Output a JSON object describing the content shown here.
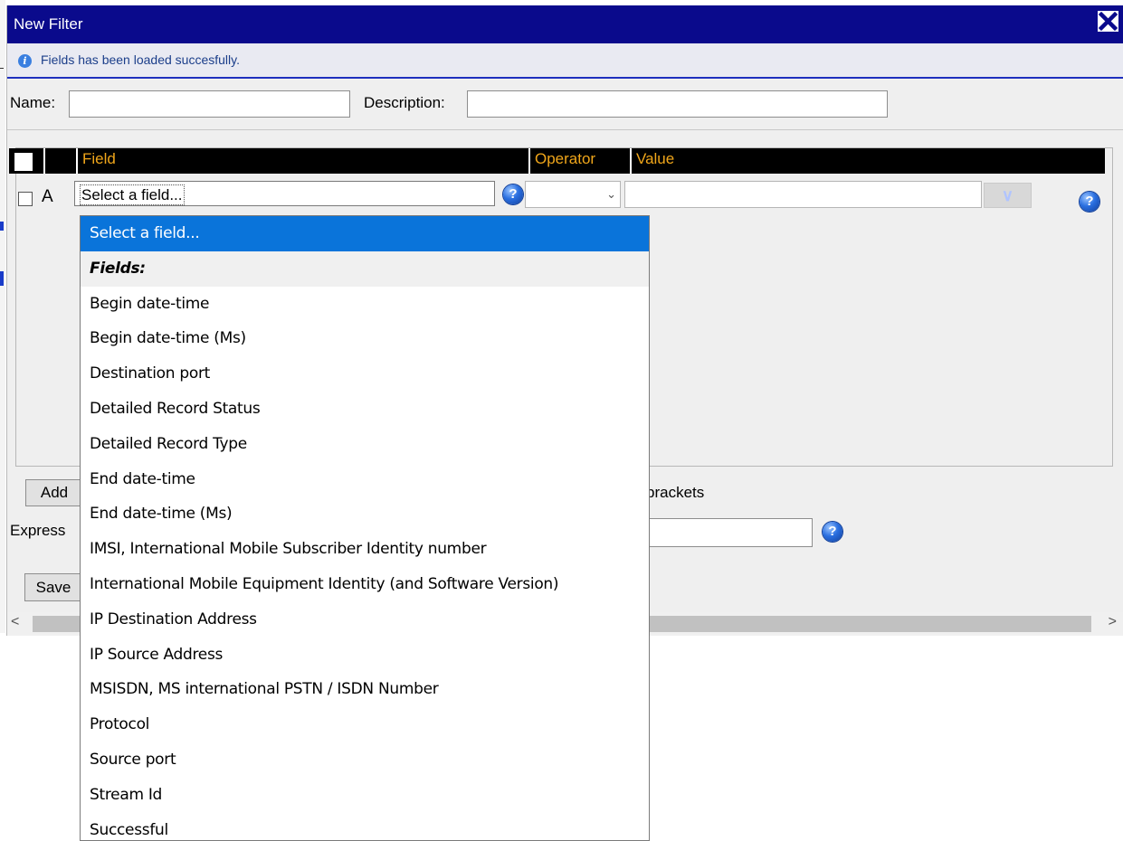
{
  "window": {
    "title": "New Filter",
    "close_icon": "close-x-icon"
  },
  "info": {
    "icon": "info-icon",
    "message": "Fields has been loaded succesfully."
  },
  "form": {
    "name_label": "Name:",
    "name_value": "",
    "description_label": "Description:",
    "description_value": ""
  },
  "grid": {
    "columns": {
      "field": "Field",
      "operator": "Operator",
      "value": "Value"
    },
    "rows": [
      {
        "letter": "A",
        "field": "Select a field...",
        "operator": "",
        "value": ""
      }
    ]
  },
  "footer": {
    "add_label": "Add",
    "brackets_text": "brackets",
    "expression_label": "Express",
    "save_label": "Save",
    "scroll_left": "<",
    "scroll_right": ">"
  },
  "dropdown": {
    "selected": "Select a field...",
    "group_label": "Fields:",
    "options": [
      "Begin date-time",
      "Begin date-time (Ms)",
      "Destination port",
      "Detailed Record Status",
      "Detailed Record Type",
      "End date-time",
      "End date-time (Ms)",
      "IMSI, International Mobile Subscriber Identity number",
      "International Mobile Equipment Identity (and Software Version)",
      "IP Destination Address",
      "IP Source Address",
      "MSISDN, MS international PSTN / ISDN Number",
      "Protocol",
      "Source port",
      "Stream Id",
      "Successful"
    ]
  },
  "colors": {
    "titlebar": "#0a0a8c",
    "header_text": "#f0a61a",
    "selected_option": "#0a74da"
  }
}
